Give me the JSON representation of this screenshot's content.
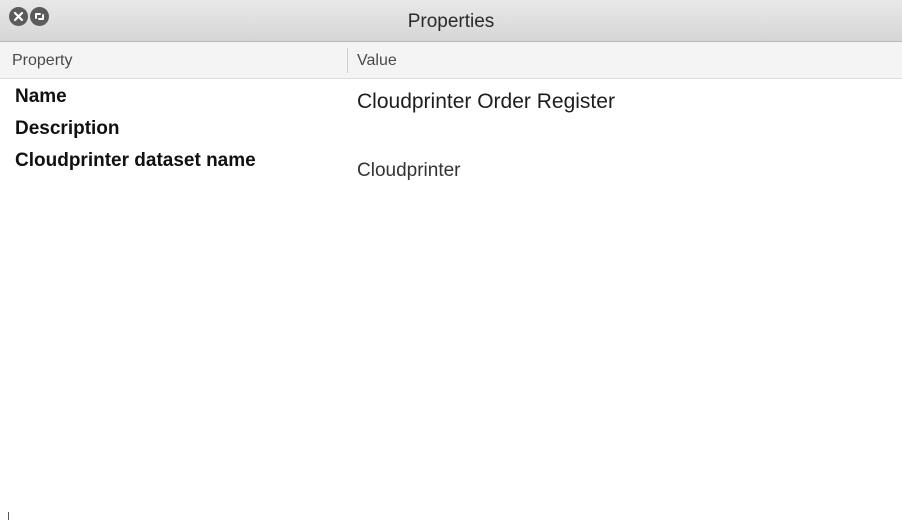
{
  "window": {
    "title": "Properties"
  },
  "titlebar": {
    "buttons": [
      {
        "icon": "close-icon"
      },
      {
        "icon": "restore-icon"
      }
    ]
  },
  "table": {
    "columns": [
      "Property",
      "Value"
    ],
    "rows": [
      {
        "property": "Name",
        "value": "Cloudprinter Order Register"
      },
      {
        "property": "Description",
        "value": ""
      },
      {
        "property": "Cloudprinter dataset name",
        "value": "Cloudprinter"
      }
    ]
  }
}
